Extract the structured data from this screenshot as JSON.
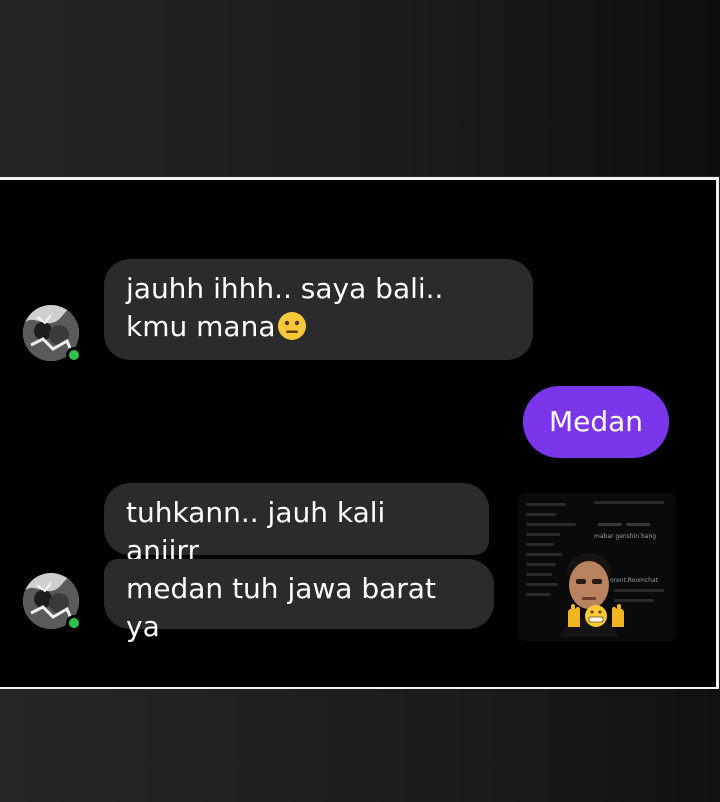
{
  "messages": [
    {
      "side": "incoming",
      "text": "jauhh ihhh.. saya bali.. kmu mana",
      "emoji": "neutral-face"
    },
    {
      "side": "outgoing",
      "text": "Medan"
    },
    {
      "side": "incoming",
      "text": "tuhkann.. jauh kali anjirr"
    },
    {
      "side": "incoming",
      "text": "medan tuh jawa barat ya"
    }
  ],
  "overlay": {
    "subtitle_1": "mabar genshin bang",
    "subtitle_2": "orent Roomchat"
  },
  "colors": {
    "incoming_bubble": "#2b2b2b",
    "outgoing_bubble": "#7b35ea",
    "online": "#2ec04a",
    "frame": "#f2f2f2"
  }
}
